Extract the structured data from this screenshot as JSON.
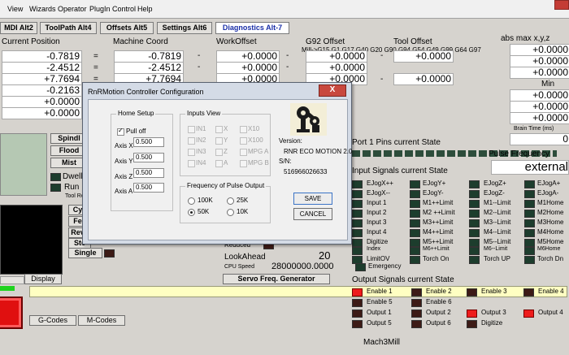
{
  "menu": [
    "View",
    "Wizards",
    "Operator",
    "PlugIn Control",
    "Help"
  ],
  "tabs": [
    {
      "label": "MDI Alt2",
      "active": false
    },
    {
      "label": "ToolPath Alt4",
      "active": false
    },
    {
      "label": "Offsets Alt5",
      "active": false
    },
    {
      "label": "Settings Alt6",
      "active": false
    },
    {
      "label": "Diagnostics Alt-7",
      "active": true
    }
  ],
  "active_gcodes": "Mill->G15  G1 G17 G40 G20 G90 G94 G54 G49 G99 G64 G97",
  "headers": {
    "current_position": "Current Position",
    "machine_coord": "Machine Coord",
    "work_offset": "WorkOffset",
    "g92_offset": "G92 Offset",
    "tool_offset": "Tool Offset",
    "abs_max": "abs max x,y,z"
  },
  "positions": {
    "current": [
      "-0.7819",
      "-2.4512",
      "+7.7694",
      "-0.2163",
      "+0.0000",
      "+0.0000"
    ],
    "machine": [
      "-0.7819",
      "-2.4512",
      "+7.7694"
    ],
    "work": [
      "+0.0000",
      "+0.0000",
      "+0.0000"
    ],
    "g92": [
      "+0.0000",
      "+0.0000",
      "+0.0000"
    ],
    "tool": [
      "+0.0000",
      "+0.0000"
    ],
    "absmax": [
      "+0.0000",
      "+0.0000",
      "+0.0000"
    ],
    "min_label": "Min",
    "absmin": [
      "+0.0000",
      "+0.0000",
      "+0.0000"
    ],
    "equals": "=",
    "minus": "-"
  },
  "brain_time": {
    "label": "Brain Time (ms)",
    "value": "0"
  },
  "left_buttons": {
    "spindle": "Spindl",
    "flood": "Flood",
    "mist": "Mist",
    "dwell": "Dwell A",
    "run": "Run",
    "tool_req": "Tool Re",
    "cycle": "Cyc",
    "feed": "Fee",
    "rev": "Reve",
    "step": "Ste",
    "single": "Single",
    "display": "Display",
    "gcodes": "G-Codes",
    "mcodes": "M-Codes"
  },
  "middle": {
    "reduced": "Reduced",
    "lookahead_label": "LookAhead",
    "lookahead_value": "20",
    "cpu_label": "CPU Speed",
    "cpu_value": "28000000.0000",
    "servo_button": "Servo Freq. Generator"
  },
  "port_pins": "Port 1 Pins current State",
  "pulse_frequency": {
    "label": "Pulse Frequency",
    "value": "external"
  },
  "input_signals_title": "Input Signals current State",
  "input_signals": [
    [
      "EJogX++",
      "EJogY+",
      "EJogZ+",
      "EJogA+"
    ],
    [
      "EJogX--",
      "EJogY-",
      "EJogZ-",
      "EJogA-"
    ],
    [
      "Input 1",
      "M1++Limit",
      "M1--Limit",
      "M1Home"
    ],
    [
      "Input 2",
      "M2 ++Limit",
      "M2--Limit",
      "M2Home"
    ],
    [
      "Input 3",
      "M3++Limit",
      "M3--Limit",
      "M3Home"
    ],
    [
      "Input 4",
      "M4++Limit",
      "M4--Limit",
      "M4Home"
    ],
    [
      "Digitize",
      "M5++Limit",
      "M5--Limit",
      "M5Home"
    ],
    [
      "Index",
      "M6++Limit",
      "M6--Limit",
      "M6Home"
    ],
    [
      "LimitOV",
      "Torch On",
      "Torch UP",
      "Torch Dn"
    ]
  ],
  "emergency": "Emergency",
  "output_signals_title": "Output Signals current State",
  "output_signals": [
    [
      "Enable 1",
      "Enable 2",
      "Enable 3",
      "Enable 4"
    ],
    [
      "Enable 5",
      "Enable 6",
      "",
      ""
    ],
    [
      "Output 1",
      "Output 2",
      "Output 3",
      "Output 4"
    ],
    [
      "Output 5",
      "Output 6",
      "Digitize",
      ""
    ]
  ],
  "output_states": [
    [
      "red",
      "dark",
      "dark",
      "dark"
    ],
    [
      "dark",
      "dark",
      "",
      ""
    ],
    [
      "dark",
      "dark",
      "red",
      "red"
    ],
    [
      "dark",
      "dark",
      "dark",
      ""
    ]
  ],
  "footer_profile": "Mach3Mill",
  "dialog": {
    "title": "RnRMotion Controller Configuration",
    "close": "X",
    "home_setup": "Home Setup",
    "pull_off": "Pull off",
    "axes": [
      {
        "label": "Axis X",
        "value": "0.500"
      },
      {
        "label": "Axis Y",
        "value": "0.500"
      },
      {
        "label": "Axis Z",
        "value": "0.500"
      },
      {
        "label": "Axis A",
        "value": "0.500"
      }
    ],
    "inputs_view": "Inputs View",
    "inputs": [
      [
        "IN1",
        "X",
        "X10"
      ],
      [
        "IN2",
        "Y",
        "X100"
      ],
      [
        "IN3",
        "Z",
        "MPG A"
      ],
      [
        "IN4",
        "A",
        "MPG B"
      ]
    ],
    "freq_title": "Frequency of Pulse Output",
    "freq_options": [
      "100K",
      "25K",
      "50K",
      "10K"
    ],
    "freq_selected": "50K",
    "version_label": "Version:",
    "version_value": "RNR ECO MOTION 2.0",
    "sn_label": "S/N:",
    "sn_value": "516966026633",
    "save": "SAVE",
    "cancel": "CANCEL"
  }
}
